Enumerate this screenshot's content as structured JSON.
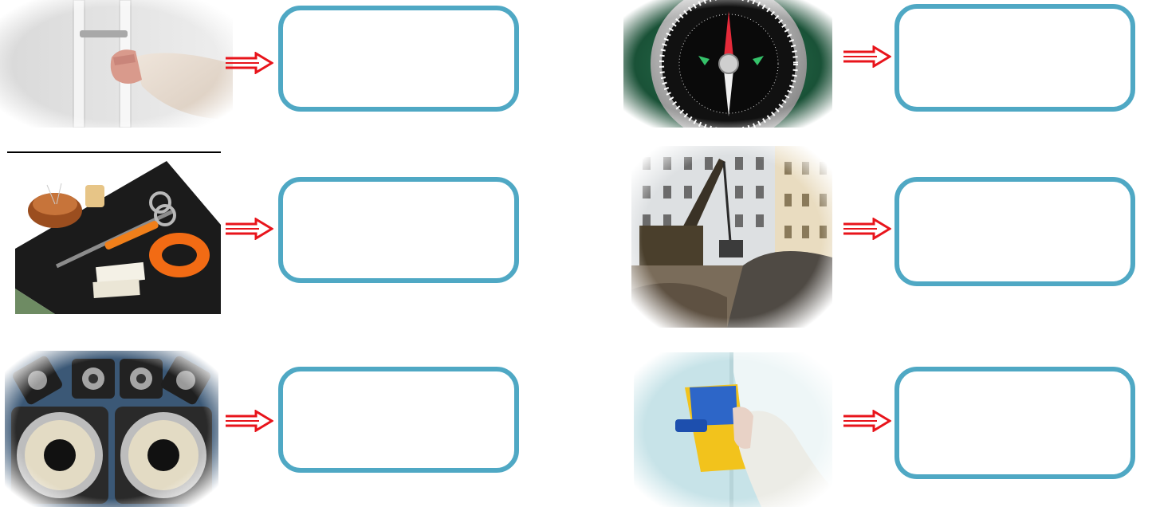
{
  "items": [
    {
      "picture": "fridge-door-icon",
      "arrow": "double-arrow-right-icon",
      "answer": ""
    },
    {
      "picture": "compass-icon",
      "arrow": "double-arrow-right-icon",
      "answer": ""
    },
    {
      "picture": "sewing-kit-icon",
      "arrow": "double-arrow-right-icon",
      "answer": ""
    },
    {
      "picture": "magnetic-crane-icon",
      "arrow": "double-arrow-right-icon",
      "answer": ""
    },
    {
      "picture": "speakers-icon",
      "arrow": "double-arrow-right-icon",
      "answer": ""
    },
    {
      "picture": "window-cleaner-icon",
      "arrow": "double-arrow-right-icon",
      "answer": ""
    }
  ],
  "colors": {
    "box_border": "#4fa8c4",
    "arrow": "#e8141b"
  }
}
